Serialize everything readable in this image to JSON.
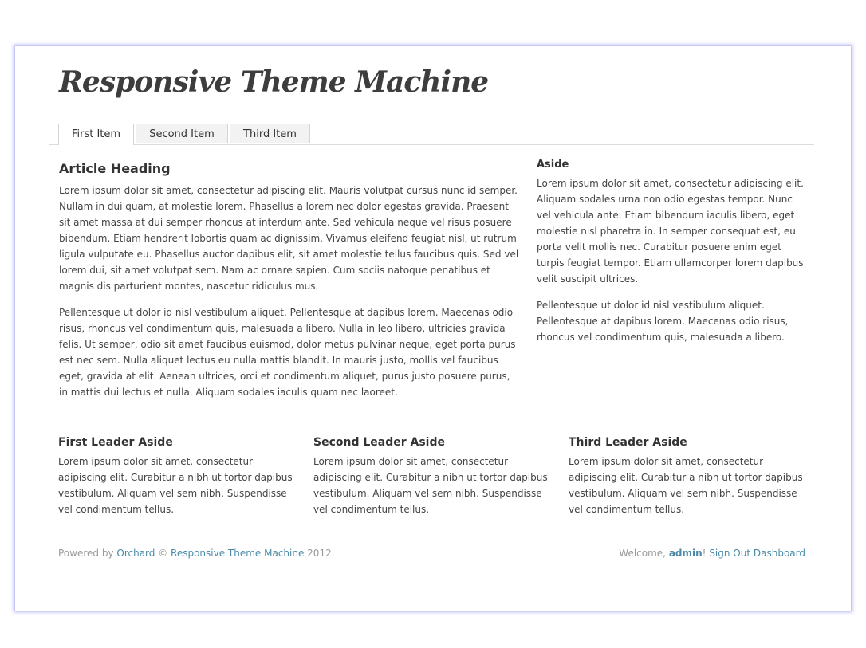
{
  "site": {
    "title": "Responsive Theme Machine"
  },
  "nav": {
    "tabs": [
      "First Item",
      "Second Item",
      "Third Item"
    ]
  },
  "article": {
    "heading": "Article Heading",
    "paragraphs": [
      "Lorem ipsum dolor sit amet, consectetur adipiscing elit. Mauris volutpat cursus nunc id semper. Nullam in dui quam, at molestie lorem. Phasellus a lorem nec dolor egestas gravida. Praesent sit amet massa at dui semper rhoncus at interdum ante. Sed vehicula neque vel risus posuere bibendum. Etiam hendrerit lobortis quam ac dignissim. Vivamus eleifend feugiat nisl, ut rutrum ligula vulputate eu. Phasellus auctor dapibus elit, sit amet molestie tellus faucibus quis. Sed vel lorem dui, sit amet volutpat sem. Nam ac ornare sapien. Cum sociis natoque penatibus et magnis dis parturient montes, nascetur ridiculus mus.",
      "Pellentesque ut dolor id nisl vestibulum aliquet. Pellentesque at dapibus lorem. Maecenas odio risus, rhoncus vel condimentum quis, malesuada a libero. Nulla in leo libero, ultricies gravida felis. Ut semper, odio sit amet faucibus euismod, dolor metus pulvinar neque, eget porta purus est nec sem. Nulla aliquet lectus eu nulla mattis blandit. In mauris justo, mollis vel faucibus eget, gravida at elit. Aenean ultrices, orci et condimentum aliquet, purus justo posuere purus, in mattis dui lectus et nulla. Aliquam sodales iaculis quam nec laoreet."
    ]
  },
  "aside": {
    "heading": "Aside",
    "paragraphs": [
      "Lorem ipsum dolor sit amet, consectetur adipiscing elit. Aliquam sodales urna non odio egestas tempor. Nunc vel vehicula ante. Etiam bibendum iaculis libero, eget molestie nisl pharetra in. In semper consequat est, eu porta velit mollis nec. Curabitur posuere enim eget turpis feugiat tempor. Etiam ullamcorper lorem dapibus velit suscipit ultrices.",
      "Pellentesque ut dolor id nisl vestibulum aliquet. Pellentesque at dapibus lorem. Maecenas odio risus, rhoncus vel condimentum quis, malesuada a libero."
    ]
  },
  "leaders": [
    {
      "heading": "First Leader Aside",
      "text": "Lorem ipsum dolor sit amet, consectetur adipiscing elit. Curabitur a nibh ut tortor dapibus vestibulum. Aliquam vel sem nibh. Suspendisse vel condimentum tellus."
    },
    {
      "heading": "Second Leader Aside",
      "text": "Lorem ipsum dolor sit amet, consectetur adipiscing elit. Curabitur a nibh ut tortor dapibus vestibulum. Aliquam vel sem nibh. Suspendisse vel condimentum tellus."
    },
    {
      "heading": "Third Leader Aside",
      "text": "Lorem ipsum dolor sit amet, consectetur adipiscing elit. Curabitur a nibh ut tortor dapibus vestibulum. Aliquam vel sem nibh. Suspendisse vel condimentum tellus."
    }
  ],
  "footer": {
    "powered_prefix": "Powered by ",
    "orchard_link": "Orchard",
    "copyright": " © ",
    "theme_link": "Responsive Theme Machine",
    "year": " 2012.",
    "welcome_prefix": "Welcome, ",
    "user": "admin",
    "exclaim": "!",
    "signout": "Sign Out",
    "dashboard": "Dashboard"
  }
}
